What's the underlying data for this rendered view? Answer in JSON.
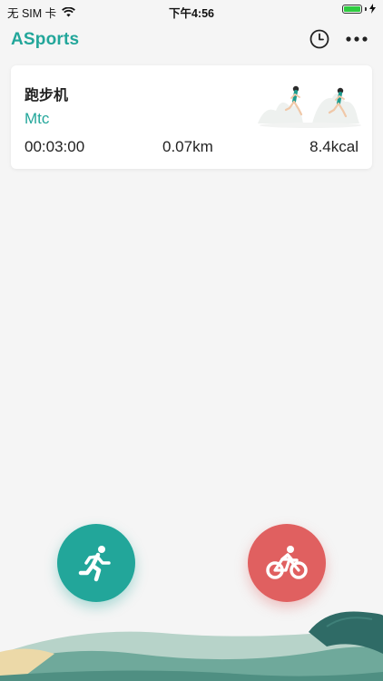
{
  "status_bar": {
    "carrier": "无 SIM 卡",
    "time": "下午4:56",
    "battery_color": "#2ecc40"
  },
  "header": {
    "title": "ASports",
    "history_icon": "clock-icon",
    "more_icon": "ellipsis-icon"
  },
  "record_card": {
    "title": "跑步机",
    "user": "Mtc",
    "duration": "00:03:00",
    "distance": "0.07km",
    "calories": "8.4kcal"
  },
  "actions": {
    "run": {
      "icon": "running-person-icon",
      "color": "#22a69a"
    },
    "bike": {
      "icon": "cyclist-icon",
      "color": "#e06060"
    }
  },
  "accent_color": "#22a69a"
}
